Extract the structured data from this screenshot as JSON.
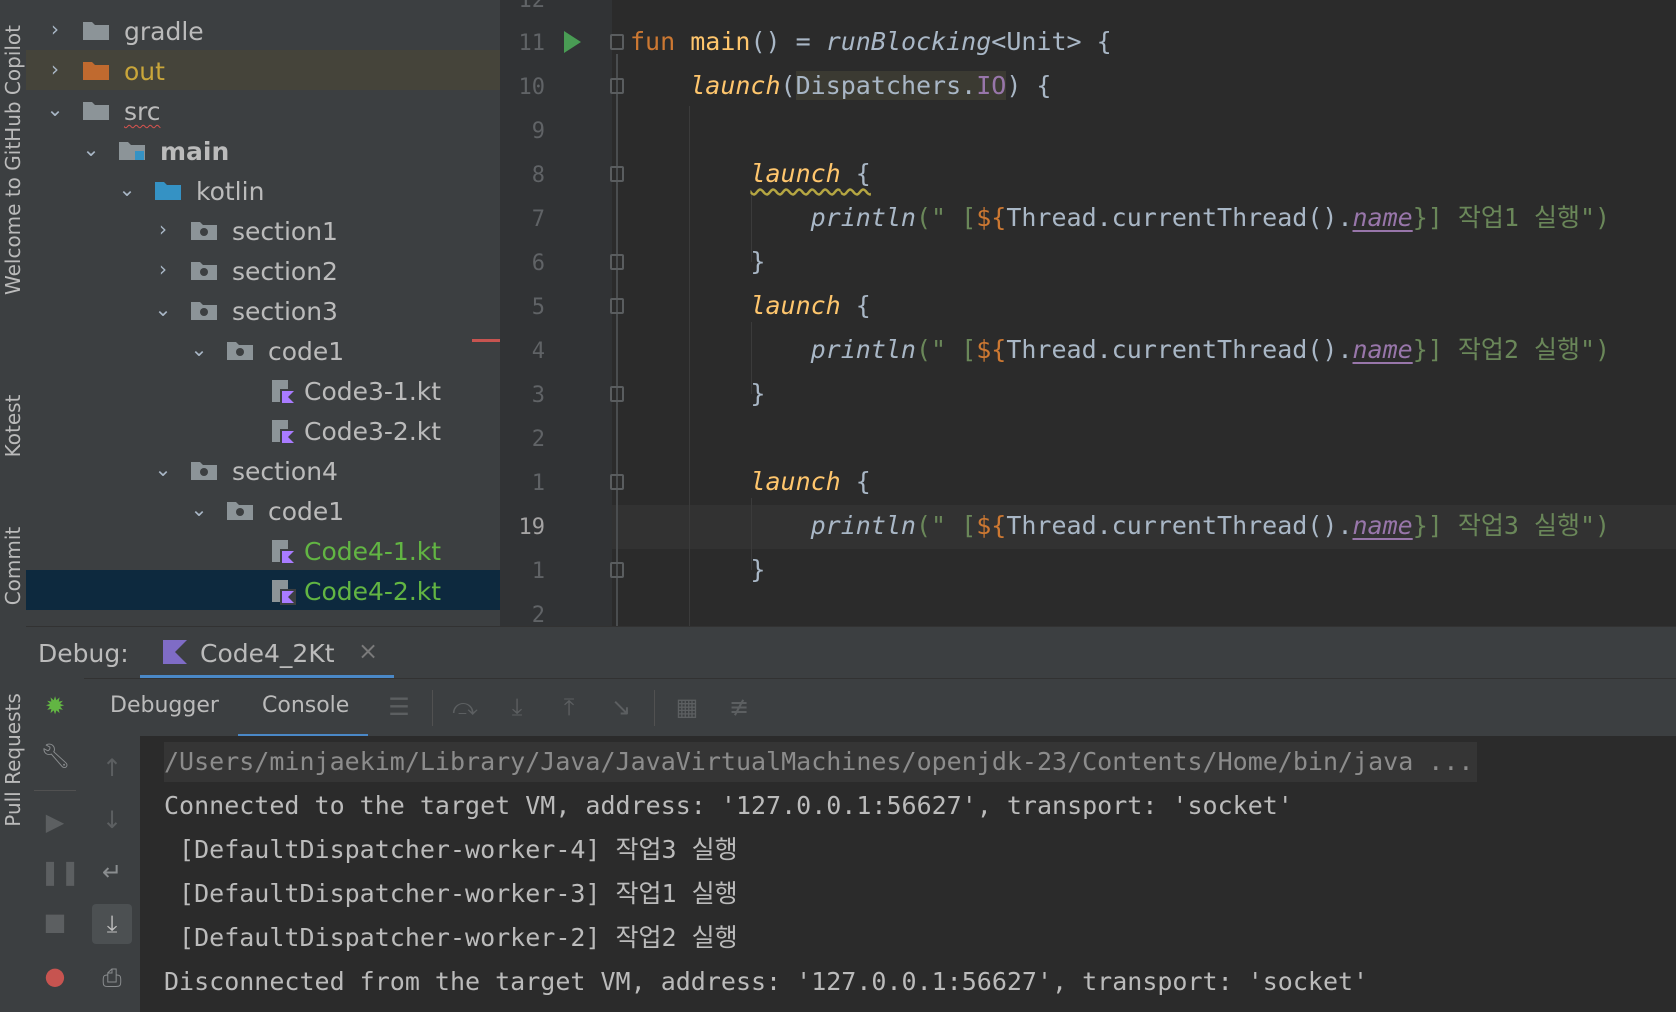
{
  "left_strip": {
    "items": [
      {
        "label": "Welcome to GitHub Copilot",
        "icon": "copilot-icon"
      },
      {
        "label": "Kotest",
        "icon": "kotest-icon"
      },
      {
        "label": "Commit",
        "icon": "commit-icon"
      },
      {
        "label": "Pull Requests",
        "icon": "pull-request-icon"
      }
    ]
  },
  "project_tree": {
    "items": [
      {
        "label": "gradle",
        "expanded": false,
        "icon": "folder-icon"
      },
      {
        "label": "out",
        "expanded": false,
        "icon": "excluded-folder-icon"
      },
      {
        "label": "src",
        "expanded": true,
        "icon": "folder-icon"
      },
      {
        "label": "main",
        "expanded": true,
        "icon": "source-folder-icon"
      },
      {
        "label": "kotlin",
        "expanded": true,
        "icon": "source-root-icon"
      },
      {
        "label": "section1",
        "expanded": false,
        "icon": "package-icon"
      },
      {
        "label": "section2",
        "expanded": false,
        "icon": "package-icon"
      },
      {
        "label": "section3",
        "expanded": true,
        "icon": "package-icon"
      },
      {
        "label": "code1",
        "expanded": true,
        "icon": "package-icon"
      },
      {
        "label": "Code3-1.kt",
        "icon": "kotlin-file-icon"
      },
      {
        "label": "Code3-2.kt",
        "icon": "kotlin-file-icon"
      },
      {
        "label": "section4",
        "expanded": true,
        "icon": "package-icon"
      },
      {
        "label": "code1",
        "expanded": true,
        "icon": "package-icon"
      },
      {
        "label": "Code4-1.kt",
        "icon": "kotlin-file-icon"
      },
      {
        "label": "Code4-2.kt",
        "icon": "kotlin-file-icon",
        "selected": true
      }
    ]
  },
  "editor": {
    "line_numbers": [
      "12",
      "11",
      "10",
      "9",
      "8",
      "7",
      "6",
      "5",
      "4",
      "3",
      "2",
      "1",
      "19",
      "1",
      "2"
    ],
    "code": {
      "l11": {
        "fun": "fun",
        "main": "main",
        "eq": "() = ",
        "rb": "runBlocking",
        "rest": "<Unit> {"
      },
      "l10": {
        "launch": "launch",
        "open": "(",
        "disp": "Dispatchers.",
        "io": "IO",
        "close": ") {"
      },
      "l8": {
        "launch": "launch",
        "brace": " {"
      },
      "l7": {
        "println": "println",
        "s1": "(\" [",
        "dollar": "${",
        "expr": "Thread.currentThread().",
        "name": "name",
        "s2": "}] 작업1 실행\")"
      },
      "l6": {
        "brace": "}"
      },
      "l5": {
        "launch": "launch",
        "brace": " {"
      },
      "l4": {
        "println": "println",
        "s1": "(\" [",
        "dollar": "${",
        "expr": "Thread.currentThread().",
        "name": "name",
        "s2": "}] 작업2 실행\")"
      },
      "l3": {
        "brace": "}"
      },
      "l1": {
        "launch": "launch",
        "brace": " {"
      },
      "l19": {
        "println": "println",
        "s1": "(\" [",
        "dollar": "${",
        "expr": "Thread.currentThread().",
        "name": "name",
        "s2": "}] 작업3 실행\")"
      },
      "l1b": {
        "brace": "}"
      }
    }
  },
  "debug": {
    "title": "Debug:",
    "session_tab": "Code4_2Kt",
    "tabs": [
      {
        "label": "Debugger",
        "active": false
      },
      {
        "label": "Console",
        "active": true
      }
    ],
    "console_lines": [
      "/Users/minjaekim/Library/Java/JavaVirtualMachines/openjdk-23/Contents/Home/bin/java ...",
      "Connected to the target VM, address: '127.0.0.1:56627', transport: 'socket'",
      " [DefaultDispatcher-worker-4] 작업3 실행",
      " [DefaultDispatcher-worker-3] 작업1 실행",
      " [DefaultDispatcher-worker-2] 작업2 실행",
      "Disconnected from the target VM, address: '127.0.0.1:56627', transport: 'socket'"
    ]
  },
  "colors": {
    "background": "#2b2b2b",
    "panel": "#3c3f41",
    "keyword": "#cc7832",
    "function": "#ffc66d",
    "string": "#6a8759",
    "property": "#9876aa",
    "selection": "#0d293e",
    "accent": "#4a88c7"
  }
}
